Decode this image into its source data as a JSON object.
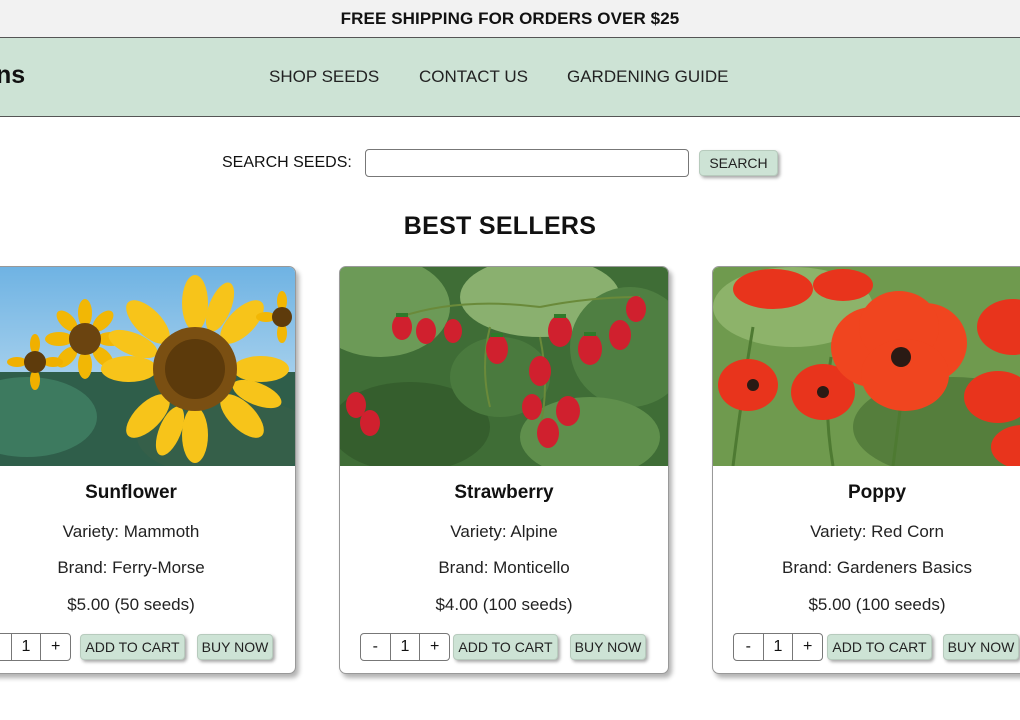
{
  "promo": "FREE SHIPPING FOR ORDERS OVER $25",
  "header": {
    "logo_fragment": "ns",
    "nav": [
      "SHOP SEEDS",
      "CONTACT US",
      "GARDENING GUIDE"
    ]
  },
  "search": {
    "label": "SEARCH SEEDS:",
    "value": "",
    "placeholder": "",
    "button": "SEARCH"
  },
  "section_title": "BEST SELLERS",
  "products": [
    {
      "name": "Sunflower",
      "variety": "Variety: Mammoth",
      "brand": "Brand: Ferry-Morse",
      "price": "$5.00 (50 seeds)",
      "qty": "1",
      "image": "sunflower-photo"
    },
    {
      "name": "Strawberry",
      "variety": "Variety: Alpine",
      "brand": "Brand: Monticello",
      "price": "$4.00 (100 seeds)",
      "qty": "1",
      "image": "strawberry-photo"
    },
    {
      "name": "Poppy",
      "variety": "Variety: Red Corn",
      "brand": "Brand: Gardeners Basics",
      "price": "$5.00 (100 seeds)",
      "qty": "1",
      "image": "poppy-photo"
    }
  ],
  "controls": {
    "minus": "-",
    "plus": "+",
    "add_to_cart": "ADD TO CART",
    "buy_now": "BUY NOW"
  },
  "colors": {
    "header_bg": "#cde3d5",
    "promo_bg": "#f2f2f2",
    "button_bg": "#cde3d5"
  }
}
